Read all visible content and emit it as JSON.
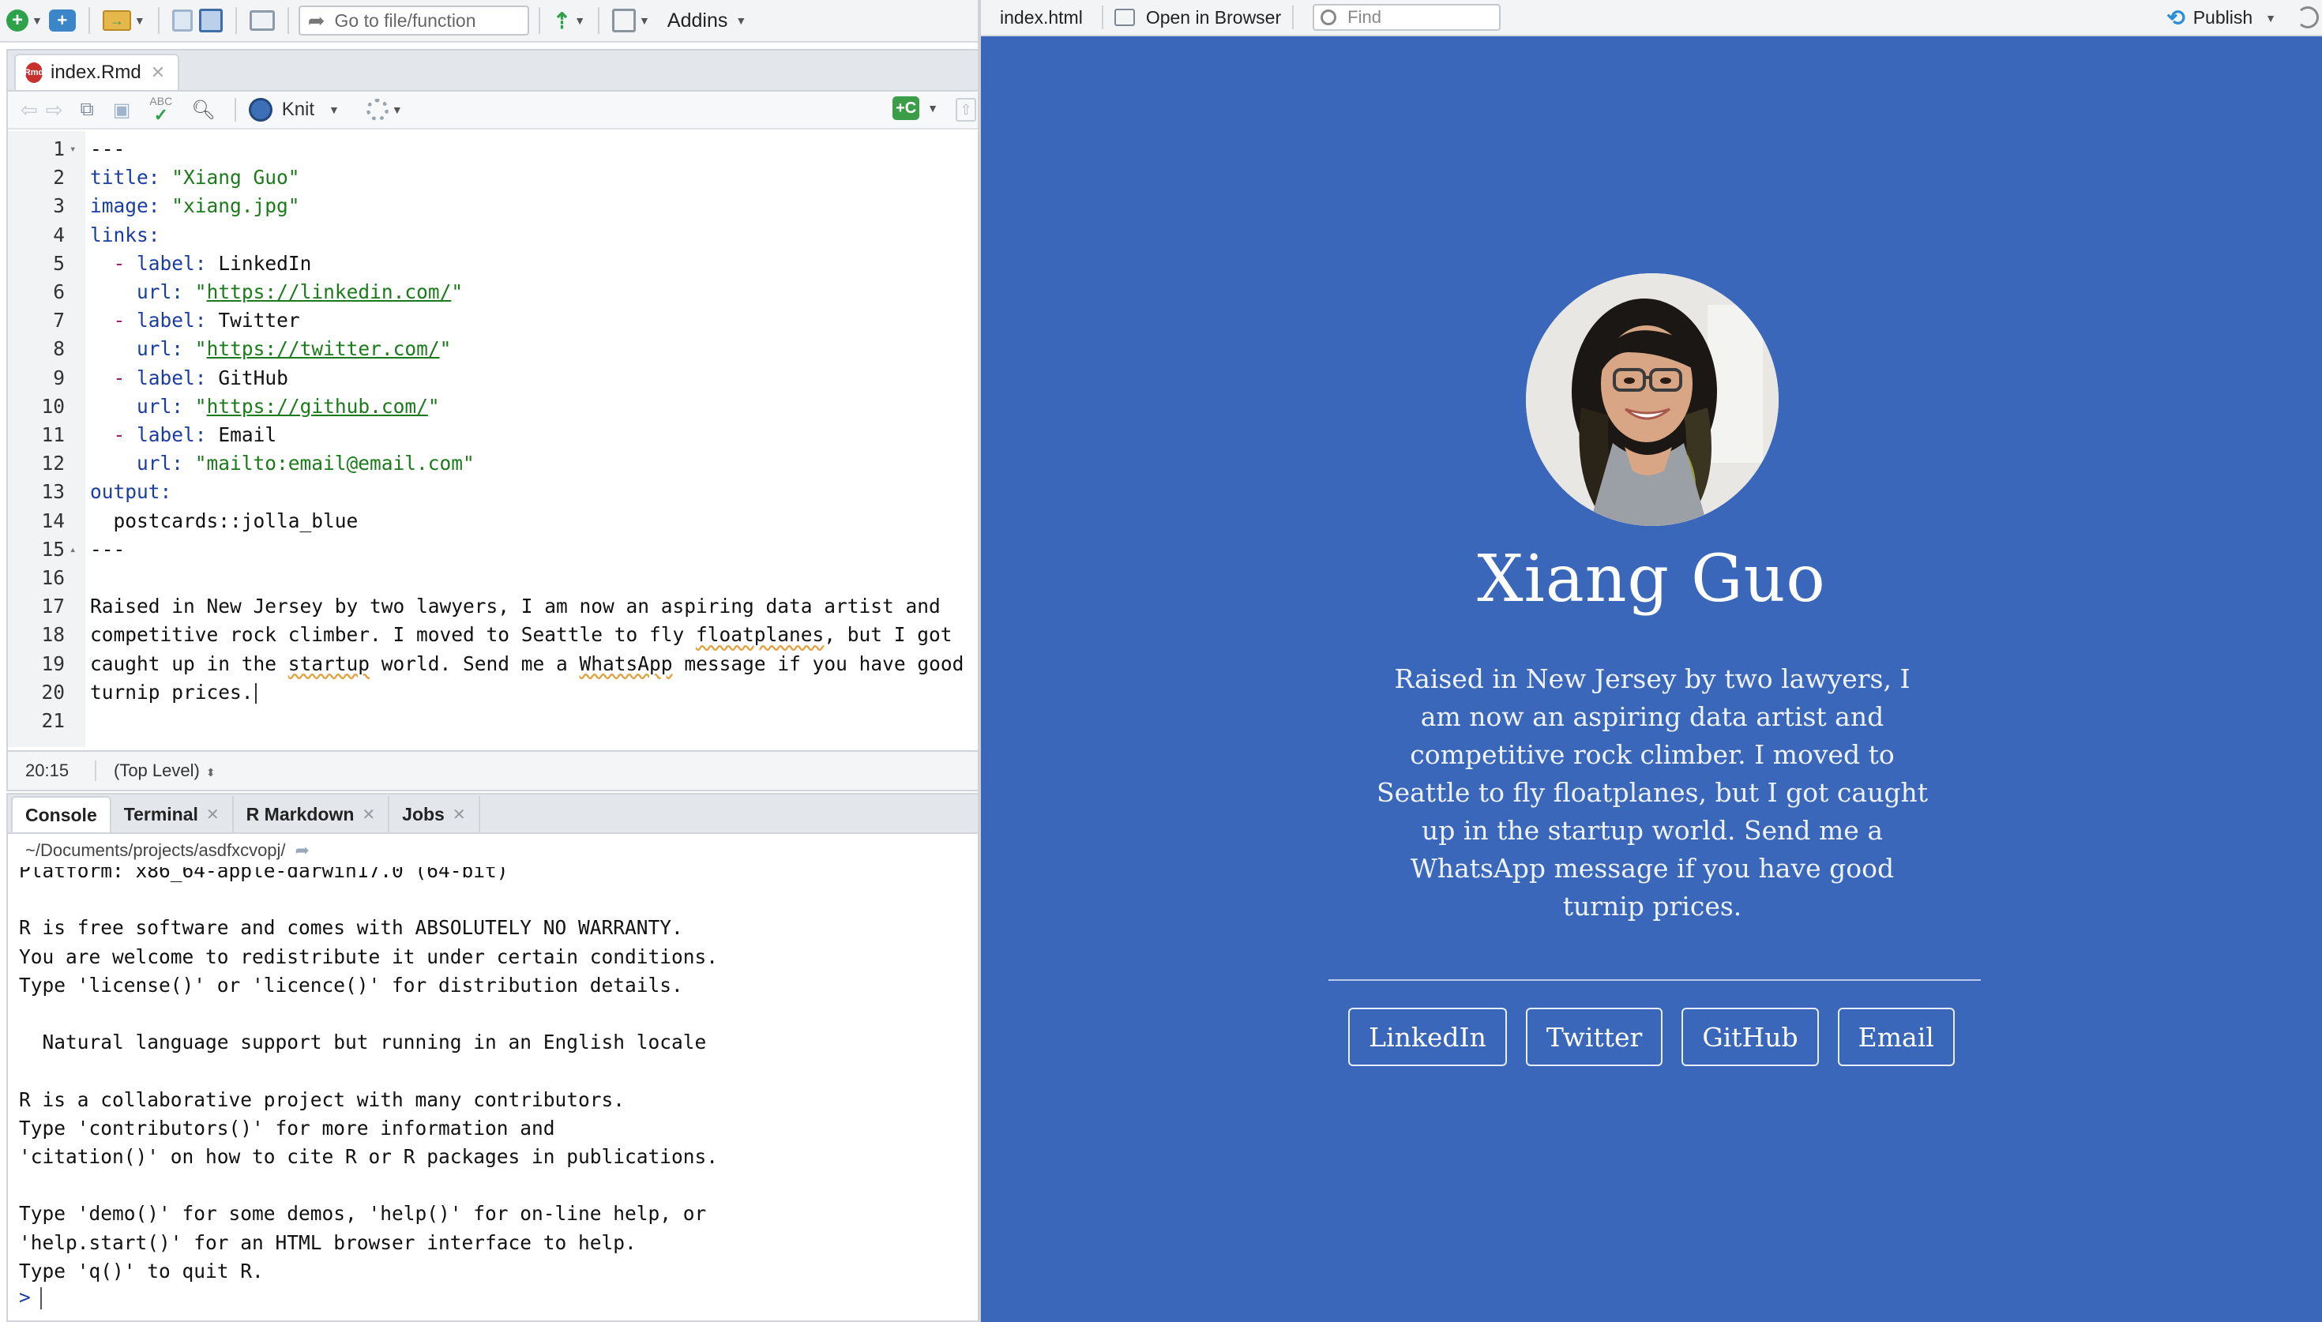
{
  "main_toolbar": {
    "goto_placeholder": "Go to file/function",
    "addins_label": "Addins"
  },
  "source": {
    "tab_name": "index.Rmd",
    "knit_label": "Knit",
    "lines": [
      {
        "n": "1",
        "fold": "▾",
        "parts": [
          {
            "t": "---",
            "c": ""
          }
        ]
      },
      {
        "n": "2",
        "fold": "",
        "parts": [
          {
            "t": "title:",
            "c": "k"
          },
          {
            "t": " ",
            "c": ""
          },
          {
            "t": "\"Xiang Guo\"",
            "c": "s"
          }
        ]
      },
      {
        "n": "3",
        "fold": "",
        "parts": [
          {
            "t": "image:",
            "c": "k"
          },
          {
            "t": " ",
            "c": ""
          },
          {
            "t": "\"xiang.jpg\"",
            "c": "s"
          }
        ]
      },
      {
        "n": "4",
        "fold": "",
        "parts": [
          {
            "t": "links:",
            "c": "k"
          }
        ]
      },
      {
        "n": "5",
        "fold": "",
        "parts": [
          {
            "t": "  ",
            "c": ""
          },
          {
            "t": "-",
            "c": "d"
          },
          {
            "t": " ",
            "c": ""
          },
          {
            "t": "label:",
            "c": "k"
          },
          {
            "t": " LinkedIn",
            "c": ""
          }
        ]
      },
      {
        "n": "6",
        "fold": "",
        "parts": [
          {
            "t": "    ",
            "c": ""
          },
          {
            "t": "url:",
            "c": "k"
          },
          {
            "t": " ",
            "c": ""
          },
          {
            "t": "\"",
            "c": "s"
          },
          {
            "t": "https://linkedin.com/",
            "c": "s u"
          },
          {
            "t": "\"",
            "c": "s"
          }
        ]
      },
      {
        "n": "7",
        "fold": "",
        "parts": [
          {
            "t": "  ",
            "c": ""
          },
          {
            "t": "-",
            "c": "d"
          },
          {
            "t": " ",
            "c": ""
          },
          {
            "t": "label:",
            "c": "k"
          },
          {
            "t": " Twitter",
            "c": ""
          }
        ]
      },
      {
        "n": "8",
        "fold": "",
        "parts": [
          {
            "t": "    ",
            "c": ""
          },
          {
            "t": "url:",
            "c": "k"
          },
          {
            "t": " ",
            "c": ""
          },
          {
            "t": "\"",
            "c": "s"
          },
          {
            "t": "https://twitter.com/",
            "c": "s u"
          },
          {
            "t": "\"",
            "c": "s"
          }
        ]
      },
      {
        "n": "9",
        "fold": "",
        "parts": [
          {
            "t": "  ",
            "c": ""
          },
          {
            "t": "-",
            "c": "d"
          },
          {
            "t": " ",
            "c": ""
          },
          {
            "t": "label:",
            "c": "k"
          },
          {
            "t": " GitHub",
            "c": ""
          }
        ]
      },
      {
        "n": "10",
        "fold": "",
        "parts": [
          {
            "t": "    ",
            "c": ""
          },
          {
            "t": "url:",
            "c": "k"
          },
          {
            "t": " ",
            "c": ""
          },
          {
            "t": "\"",
            "c": "s"
          },
          {
            "t": "https://github.com/",
            "c": "s u"
          },
          {
            "t": "\"",
            "c": "s"
          }
        ]
      },
      {
        "n": "11",
        "fold": "",
        "parts": [
          {
            "t": "  ",
            "c": ""
          },
          {
            "t": "-",
            "c": "d"
          },
          {
            "t": " ",
            "c": ""
          },
          {
            "t": "label:",
            "c": "k"
          },
          {
            "t": " Email",
            "c": ""
          }
        ]
      },
      {
        "n": "12",
        "fold": "",
        "parts": [
          {
            "t": "    ",
            "c": ""
          },
          {
            "t": "url:",
            "c": "k"
          },
          {
            "t": " ",
            "c": ""
          },
          {
            "t": "\"mailto:email@email.com\"",
            "c": "s"
          }
        ]
      },
      {
        "n": "13",
        "fold": "",
        "parts": [
          {
            "t": "output:",
            "c": "k"
          }
        ]
      },
      {
        "n": "14",
        "fold": "",
        "parts": [
          {
            "t": "  postcards::jolla_blue",
            "c": ""
          }
        ]
      },
      {
        "n": "15",
        "fold": "▴",
        "parts": [
          {
            "t": "---",
            "c": ""
          }
        ]
      },
      {
        "n": "16",
        "fold": "",
        "parts": []
      },
      {
        "n": "17",
        "fold": "",
        "parts": [
          {
            "t": "Raised in New Jersey by two lawyers, I am now an aspiring data artist and",
            "c": ""
          }
        ]
      },
      {
        "n": "18",
        "fold": "",
        "parts": [
          {
            "t": "competitive rock climber. I moved to Seattle to fly ",
            "c": ""
          },
          {
            "t": "floatplanes",
            "c": "sq"
          },
          {
            "t": ", but I got",
            "c": ""
          }
        ]
      },
      {
        "n": "19",
        "fold": "",
        "parts": [
          {
            "t": "caught up in the ",
            "c": ""
          },
          {
            "t": "startup",
            "c": "sq"
          },
          {
            "t": " world. Send me a ",
            "c": ""
          },
          {
            "t": "WhatsApp",
            "c": "sq"
          },
          {
            "t": " message if you have good",
            "c": ""
          }
        ]
      },
      {
        "n": "20",
        "fold": "",
        "parts": [
          {
            "t": "turnip prices.",
            "c": ""
          }
        ],
        "cursor": true
      },
      {
        "n": "21",
        "fold": "",
        "parts": []
      }
    ],
    "status": {
      "position": "20:15",
      "scope": "(Top Level)"
    }
  },
  "console": {
    "tabs": [
      {
        "label": "Console",
        "closable": false,
        "active": true
      },
      {
        "label": "Terminal",
        "closable": true,
        "active": false
      },
      {
        "label": "R Markdown",
        "closable": true,
        "active": false
      },
      {
        "label": "Jobs",
        "closable": true,
        "active": false
      }
    ],
    "path": "~/Documents/projects/asdfxcvopj/",
    "output": [
      "Platform: x86_64-apple-darwin17.0 (64-bit)",
      "",
      "R is free software and comes with ABSOLUTELY NO WARRANTY.",
      "You are welcome to redistribute it under certain conditions.",
      "Type 'license()' or 'licence()' for distribution details.",
      "",
      "  Natural language support but running in an English locale",
      "",
      "R is a collaborative project with many contributors.",
      "Type 'contributors()' for more information and",
      "'citation()' on how to cite R or R packages in publications.",
      "",
      "Type 'demo()' for some demos, 'help()' for on-line help, or",
      "'help.start()' for an HTML browser interface to help.",
      "Type 'q()' to quit R."
    ],
    "prompt": ">"
  },
  "viewer": {
    "file": "index.html",
    "open_in_browser": "Open in Browser",
    "find_placeholder": "Find",
    "publish_label": "Publish"
  },
  "site": {
    "name": "Xiang Guo",
    "bio": "Raised in New Jersey by two lawyers, I am now an aspiring data artist and competitive rock climber. I moved to Seattle to fly floatplanes, but I got caught up in the startup world. Send me a WhatsApp message if you have good turnip prices.",
    "links": [
      "LinkedIn",
      "Twitter",
      "GitHub",
      "Email"
    ],
    "background_color": "#3a67b9"
  }
}
